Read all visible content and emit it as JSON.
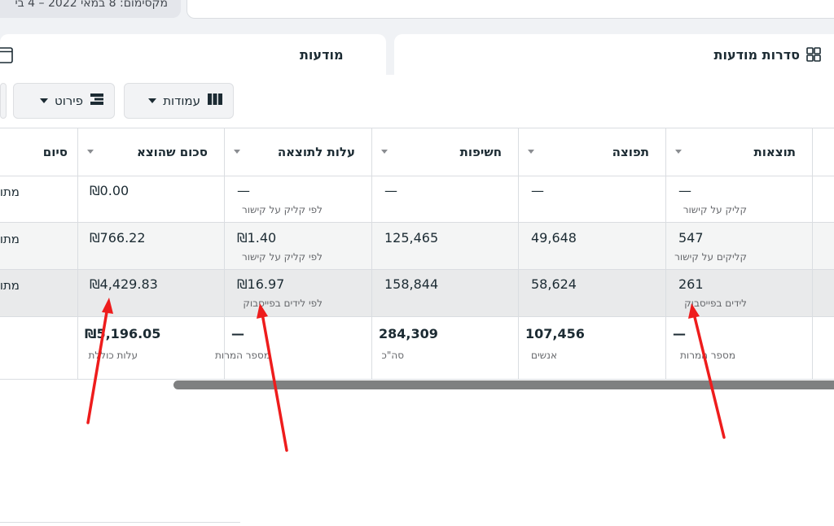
{
  "header": {
    "date_range": "מקסימום: 8 במאי 2022 – 4 בי"
  },
  "tabs": {
    "ad_sets": {
      "label": "סדרות מודעות",
      "icon": "ad-sets-icon"
    },
    "ads": {
      "label": "מודעות",
      "icon": "ads-window-icon"
    }
  },
  "toolbar": {
    "columns_label": "עמודות",
    "breakdown_label": "פירוט"
  },
  "table": {
    "headers": {
      "results": "תוצאות",
      "reach": "תפוצה",
      "impressions": "חשיפות",
      "cost_per_result": "עלות לתוצאה",
      "amount_spent": "סכום שהוצא",
      "ends": "סיום"
    },
    "rows": [
      {
        "results": "—",
        "results_sub": "קליק על קישור",
        "reach": "—",
        "impressions": "—",
        "cost": "—",
        "cost_sub": "לפי קליק על קישור",
        "spent": "₪0.00",
        "ends": "מתו"
      },
      {
        "results": "547",
        "results_sub": "קליקים על קישור",
        "reach": "49,648",
        "impressions": "125,465",
        "cost": "₪1.40",
        "cost_sub": "לפי קליק על קישור",
        "spent": "₪766.22",
        "ends": "מתו"
      },
      {
        "results": "261",
        "results_sub": "לידים בפייסבוק",
        "reach": "58,624",
        "impressions": "158,844",
        "cost": "₪16.97",
        "cost_sub": "לפי לידים בפייסבוק",
        "spent": "₪4,429.83",
        "ends": "מתו"
      }
    ],
    "totals": {
      "results": "—",
      "results_sub": "מספר המרות",
      "reach": "107,456",
      "reach_sub": "אנשים",
      "impressions": "284,309",
      "impressions_sub": "סה\"כ",
      "cost": "—",
      "cost_sub": "מספר המרות",
      "spent": "₪5,196.05",
      "spent_sub": "עלות כוללת"
    }
  },
  "colors": {
    "annotation_arrow": "#ee1c1c",
    "row_highlight": "#e9eaeb",
    "row_alt": "#f4f5f5"
  }
}
